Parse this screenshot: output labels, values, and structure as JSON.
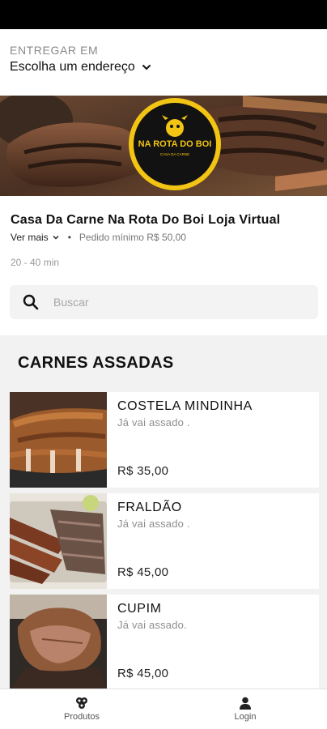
{
  "header": {
    "deliver_label": "ENTREGAR EM",
    "address_placeholder": "Escolha um endereço"
  },
  "hero": {
    "logo_line1": "NA ROTA DO BOI",
    "logo_line2": "CASA DA CARNE"
  },
  "store": {
    "name": "Casa Da Carne Na Rota Do Boi Loja Virtual",
    "see_more": "Ver mais",
    "separator": "•",
    "min_order": "Pedido mínimo R$ 50,00",
    "delivery_time": "20 - 40 min"
  },
  "search": {
    "placeholder": "Buscar"
  },
  "category": {
    "title": "CARNES ASSADAS"
  },
  "products": [
    {
      "name": "COSTELA MINDINHA",
      "description": "Já vai assado .",
      "price": "R$ 35,00"
    },
    {
      "name": "FRALDÃO",
      "description": "Já vai assado .",
      "price": "R$ 45,00"
    },
    {
      "name": "CUPIM",
      "description": "Já vai assado.",
      "price": "R$ 45,00"
    }
  ],
  "bottom_nav": [
    {
      "label": "Produtos",
      "icon": "products-icon"
    },
    {
      "label": "Login",
      "icon": "user-icon"
    }
  ]
}
